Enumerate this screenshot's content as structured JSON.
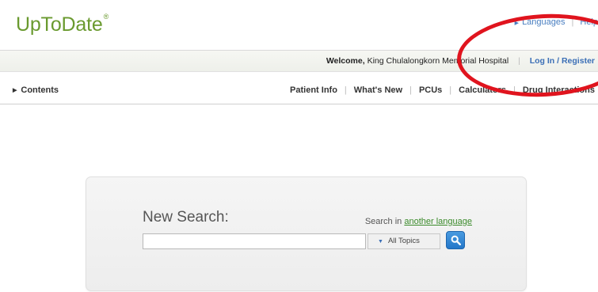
{
  "header": {
    "logo_text": "UpToDate",
    "logo_mark": "®",
    "links": {
      "languages": "Languages",
      "help": "Help"
    }
  },
  "welcome_bar": {
    "welcome_label": "Welcome,",
    "institution": "King Chulalongkorn Memorial Hospital",
    "login_label": "Log In / Register"
  },
  "nav": {
    "contents_label": "Contents",
    "links": [
      "Patient Info",
      "What's New",
      "PCUs",
      "Calculators",
      "Drug Interactions"
    ]
  },
  "search": {
    "title": "New Search:",
    "language_prefix": "Search in",
    "language_link": "another language",
    "input_value": "",
    "input_placeholder": "",
    "topics_selected": "All Topics"
  },
  "colors": {
    "brand_green": "#6a9a2f",
    "link_blue": "#3b6fb6",
    "annotation_red": "#e0141e",
    "search_button": "#2377c9"
  },
  "icons": {
    "search_button": "search-icon",
    "topics_caret": "caret-down-icon",
    "languages_arrow": "triangle-right-icon",
    "contents_arrow": "triangle-right-icon"
  }
}
